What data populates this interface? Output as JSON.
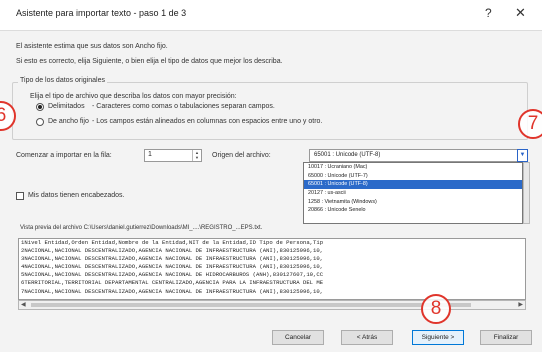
{
  "window": {
    "title": "Asistente para importar texto - paso 1 de 3",
    "help_label": "?",
    "close_label": "✕"
  },
  "intro": {
    "line1": "El asistente estima que sus datos son Ancho fijo.",
    "line2": "Si esto es correcto, elija Siguiente, o bien elija el tipo de datos que mejor los describa."
  },
  "original_data_type": {
    "section_label": "Tipo de los datos originales",
    "prompt": "Elija el tipo de archivo que describa los datos con mayor precisión:",
    "options": [
      {
        "label": "Delimitados",
        "desc": "- Caracteres como comas o tabulaciones separan campos.",
        "checked": true
      },
      {
        "label": "De ancho fijo",
        "desc": "- Los campos están alineados en columnas con espacios entre uno y otro.",
        "checked": false
      }
    ]
  },
  "start_row": {
    "label": "Comenzar a importar en la fila:",
    "value": "1"
  },
  "file_origin": {
    "label": "Origen del archivo:",
    "value": "65001 : Unicode (UTF-8)",
    "dropdown_options": [
      "10017 : Ucraniano (Mac)",
      "65000 : Unicode (UTF-7)",
      "65001 : Unicode (UTF-8)",
      "20127 : us-ascii",
      "1258 : Vietnamita (Windows)",
      "20866 : Unicode Senelo"
    ],
    "selected_index": 2
  },
  "headers_checkbox": {
    "label": "Mis datos tienen encabezados.",
    "checked": false
  },
  "preview": {
    "label": "Vista previa del archivo C:\\Users\\daniel.gutierrez\\Downloads\\MI_....\\REGISTRO_...EPS.txt.",
    "lines": [
      "1Nivel Entidad,Orden Entidad,Nombre de la Entidad,NIT de la Entidad,ID Tipo de Persona,Tip",
      "2NACIONAL,NACIONAL DESCENTRALIZADO,AGENCIA NACIONAL DE INFRAESTRUCTURA (ANI),830125996,10,",
      "3NACIONAL,NACIONAL DESCENTRALIZADO,AGENCIA NACIONAL DE INFRAESTRUCTURA (ANI),830125996,10,",
      "4NACIONAL,NACIONAL DESCENTRALIZADO,AGENCIA NACIONAL DE INFRAESTRUCTURA (ANI),830125996,10,",
      "5NACIONAL,NACIONAL DESCENTRALIZADO,AGENCIA NACIONAL DE HIDROCARBUROS (ANH),830127607,10,CC",
      "6TERRITORIAL,TERRITORIAL DEPARTAMENTAL CENTRALIZADO,AGENCIA PARA LA INFRAESTRUCTURA DEL ME",
      "7NACIONAL,NACIONAL DESCENTRALIZADO,AGENCIA NACIONAL DE INFRAESTRUCTURA (ANI),830125996,10,"
    ]
  },
  "buttons": {
    "cancel": "Cancelar",
    "back": "< Atrás",
    "next": "Siguiente >",
    "finish": "Finalizar"
  },
  "markers": {
    "left": "6",
    "right": "7",
    "bottom": "8"
  },
  "colors": {
    "selection": "#2b6ac9",
    "marker": "#e0352b",
    "primary_border": "#0078d7"
  }
}
